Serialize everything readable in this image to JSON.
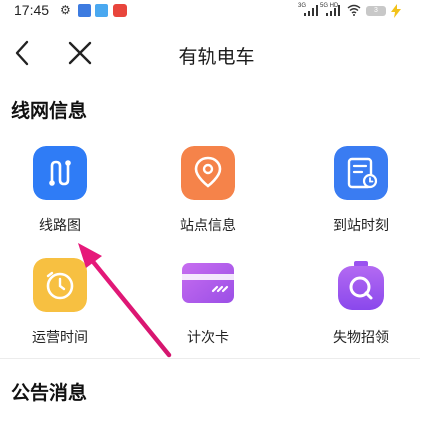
{
  "status_bar": {
    "time": "17:45",
    "signal_1_label": "3G",
    "signal_2_label": "5G HD",
    "battery_level": "3",
    "icons": [
      "gear-icon",
      "app-notification-icon",
      "cloud-notification-icon",
      "gift-notification-icon",
      "wifi-icon",
      "charging-icon"
    ]
  },
  "header": {
    "title": "有轨电车",
    "back_icon": "back-chevron-icon",
    "close_icon": "close-icon"
  },
  "sections": [
    {
      "title": "线网信息",
      "items": [
        {
          "label": "线路图",
          "icon": "route-map-icon",
          "color": "#2f7cf6"
        },
        {
          "label": "站点信息",
          "icon": "location-pin-icon",
          "color": "#f5834a"
        },
        {
          "label": "到站时刻",
          "icon": "schedule-doc-icon",
          "color": "#3a7cf2"
        },
        {
          "label": "运营时间",
          "icon": "clock-icon",
          "color": "#f7c041"
        },
        {
          "label": "计次卡",
          "icon": "card-icon",
          "color": "#b05ae8"
        },
        {
          "label": "失物招领",
          "icon": "search-bag-icon",
          "color": "#9a52f0"
        }
      ]
    },
    {
      "title": "公告消息",
      "items": []
    }
  ],
  "annotation": {
    "type": "arrow",
    "color": "#e6197a",
    "points_to": "线路图"
  }
}
